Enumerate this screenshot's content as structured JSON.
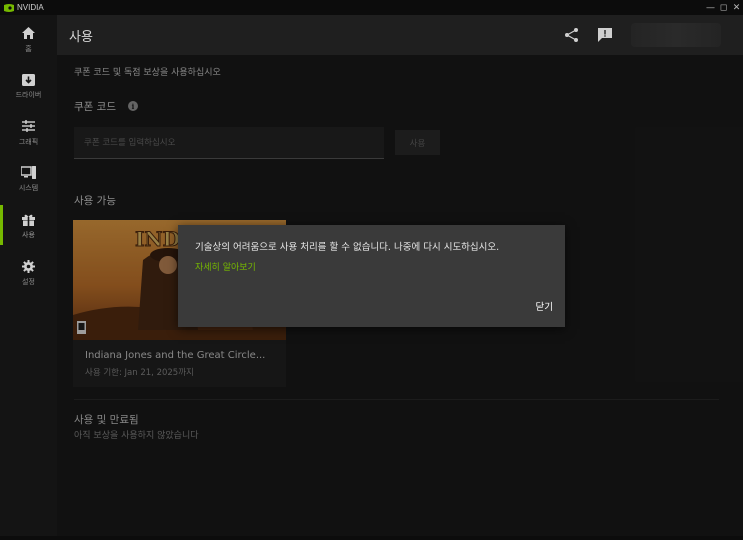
{
  "window": {
    "title": "NVIDIA",
    "controls": {
      "minimize": "—",
      "maximize": "◻",
      "close": "✕"
    }
  },
  "sidebar": {
    "items": [
      {
        "label": "홈",
        "icon": "home-icon"
      },
      {
        "label": "드라이버",
        "icon": "driver-icon"
      },
      {
        "label": "그래픽",
        "icon": "sliders-icon"
      },
      {
        "label": "시스템",
        "icon": "monitor-icon"
      },
      {
        "label": "사용",
        "icon": "gift-icon",
        "active": true
      },
      {
        "label": "설정",
        "icon": "gear-icon"
      }
    ],
    "accent_color": "#76b900"
  },
  "header": {
    "title": "사용",
    "icons": [
      "share-icon",
      "feedback-icon"
    ]
  },
  "redeem": {
    "subtitle": "쿠폰 코드 및 독점 보상을 사용하십시오",
    "coupon_label": "쿠폰 코드",
    "coupon_placeholder": "쿠폰 코드를 입력하십시오",
    "coupon_value": "",
    "apply_label": "사용"
  },
  "available": {
    "title": "사용 가능",
    "rewards": [
      {
        "name": "Indiana Jones and the Great Circle...",
        "expiry": "사용 기한: Jan 21, 2025까지",
        "art_text": "INDI"
      }
    ]
  },
  "used": {
    "title": "사용 및 만료됨",
    "empty_text": "아직 보상을 사용하지 않았습니다"
  },
  "dialog": {
    "message": "기술상의 어려움으로 사용 처리를 할 수 없습니다. 나중에 다시 시도하십시오.",
    "learn_more": "자세히 알아보기",
    "close_label": "닫기"
  }
}
